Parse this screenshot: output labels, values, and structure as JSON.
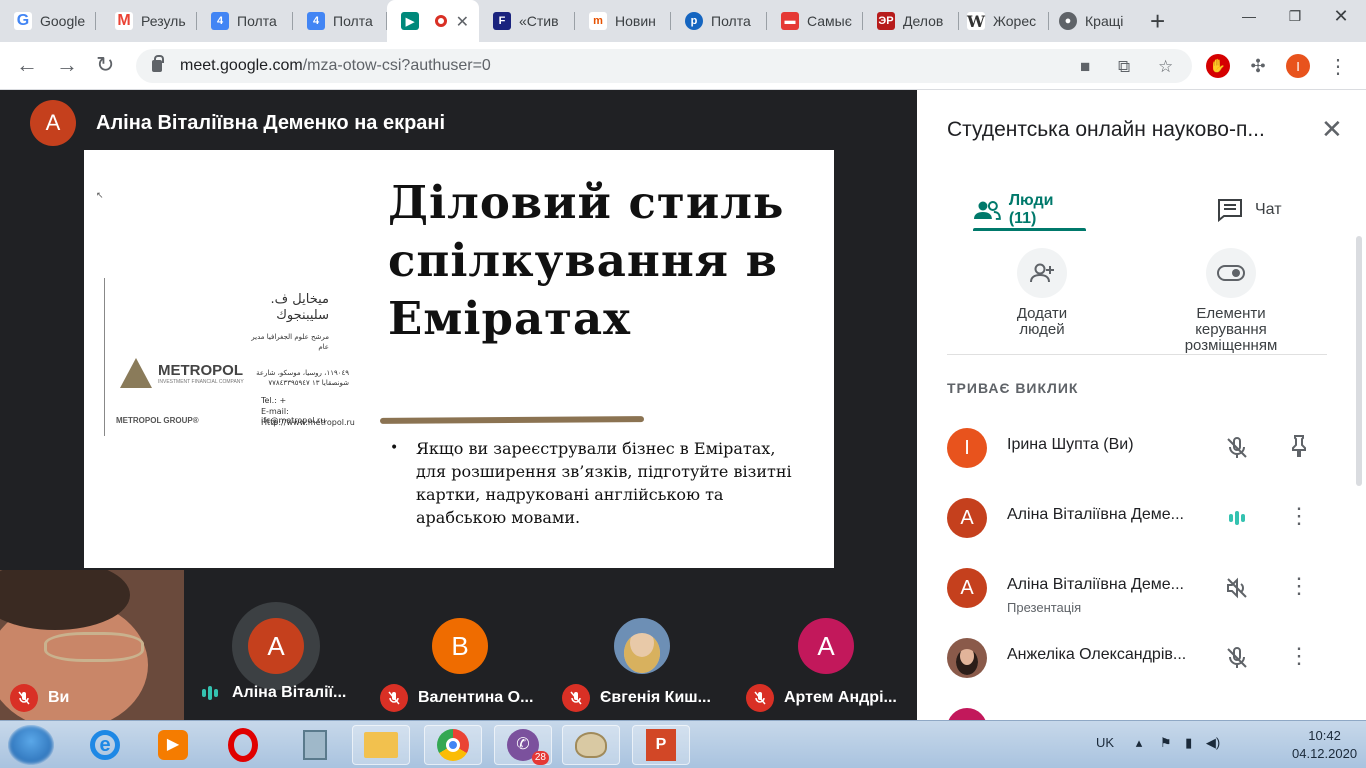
{
  "browser": {
    "tabs": [
      {
        "label": "Google",
        "icon": "google-icon",
        "color": "#4285f4"
      },
      {
        "label": "Резуль",
        "icon": "gmail-icon",
        "color": "#ea4335"
      },
      {
        "label": "Полта",
        "icon": "calendar-icon",
        "color": "#4285f4"
      },
      {
        "label": "Полта",
        "icon": "calendar-icon",
        "color": "#4285f4"
      },
      {
        "label": "",
        "icon": "meet-icon",
        "color": "#00897b",
        "active": true
      },
      {
        "label": "«Стив",
        "icon": "f-icon",
        "color": "#1a237e"
      },
      {
        "label": "Новин",
        "icon": "news-icon",
        "color": "#e65100"
      },
      {
        "label": "Полта",
        "icon": "globe-icon",
        "color": "#1565c0"
      },
      {
        "label": "Самыє",
        "icon": "card-icon",
        "color": "#e53935"
      },
      {
        "label": "Делов",
        "icon": "dr-icon",
        "color": "#b71c1c"
      },
      {
        "label": "Жорес",
        "icon": "wikipedia-icon",
        "color": "#333333"
      },
      {
        "label": "Кращі",
        "icon": "globe-icon",
        "color": "#5f6368"
      }
    ],
    "url_host": "meet.google.com",
    "url_path": "/mza-otow-csi?authuser=0",
    "profile_initial": "І"
  },
  "meeting": {
    "presenter_initial": "A",
    "presenter_label": "Аліна Віталіївна Деменко на екрані",
    "slide": {
      "title": "Діловий стиль спілкування в Еміратах",
      "bullet": "Якщо ви зареєстрували бізнес в Еміратах, для розширення зв’язків, підготуйте візитні картки, надруковані англійською та арабською мовами.",
      "card_logo": "METROPOL",
      "card_logo_sub": "INVESTMENT FINANCIAL COMPANY",
      "card_group": "METROPOL GROUP®",
      "card_arabic_name": "ميخايل ف. سليبنجوك",
      "card_arabic_title": "مرشح علوم الجغرافيا مدير عام",
      "card_arabic_addr": "١١٩٠٤٩، روسيا، موسكو، شارعة شونصقايا ١٣ ٧٧٨٤٣٣٩٥٩٤٧",
      "card_email": "E-mail: ifc@metropol.ru",
      "card_web": "Http://www.metropol.ru",
      "card_tel": "Tel.: +"
    },
    "tiles": [
      {
        "name": "Ви",
        "muted": true,
        "self": true
      },
      {
        "initial": "A",
        "name": "Аліна Віталії...",
        "speaking": true,
        "color": "#c5401d"
      },
      {
        "initial": "B",
        "name": "Валентина О...",
        "muted": true,
        "color": "#ef6c00"
      },
      {
        "initial": "",
        "name": "Євгенія Киш...",
        "muted": true,
        "color": "#6d8fb5"
      },
      {
        "initial": "A",
        "name": "Артем Андрі...",
        "muted": true,
        "color": "#c2185b"
      }
    ]
  },
  "sidepanel": {
    "title": "Студентська онлайн науково-п...",
    "tab_people": "Люди (11)",
    "tab_chat": "Чат",
    "add_people": "Додати людей",
    "layout_controls": "Елементи керування розміщенням",
    "section": "ТРИВАЄ ВИКЛИК",
    "participants": [
      {
        "initial": "І",
        "name": "Ірина Шупта (Ви)",
        "sub": "",
        "color": "#e8531d",
        "state": "muted"
      },
      {
        "initial": "A",
        "name": "Аліна Віталіївна Деме...",
        "sub": "",
        "color": "#c5401d",
        "state": "speaking"
      },
      {
        "initial": "A",
        "name": "Аліна Віталіївна Деме...",
        "sub": "Презентація",
        "color": "#c5401d",
        "state": "volume-off"
      },
      {
        "initial": "",
        "name": "Анжеліка Олександрів...",
        "sub": "",
        "color": "#8a5a4a",
        "state": "muted"
      }
    ]
  },
  "taskbar": {
    "language": "UK",
    "time": "10:42",
    "date": "04.12.2020",
    "viber_badge": "28"
  }
}
